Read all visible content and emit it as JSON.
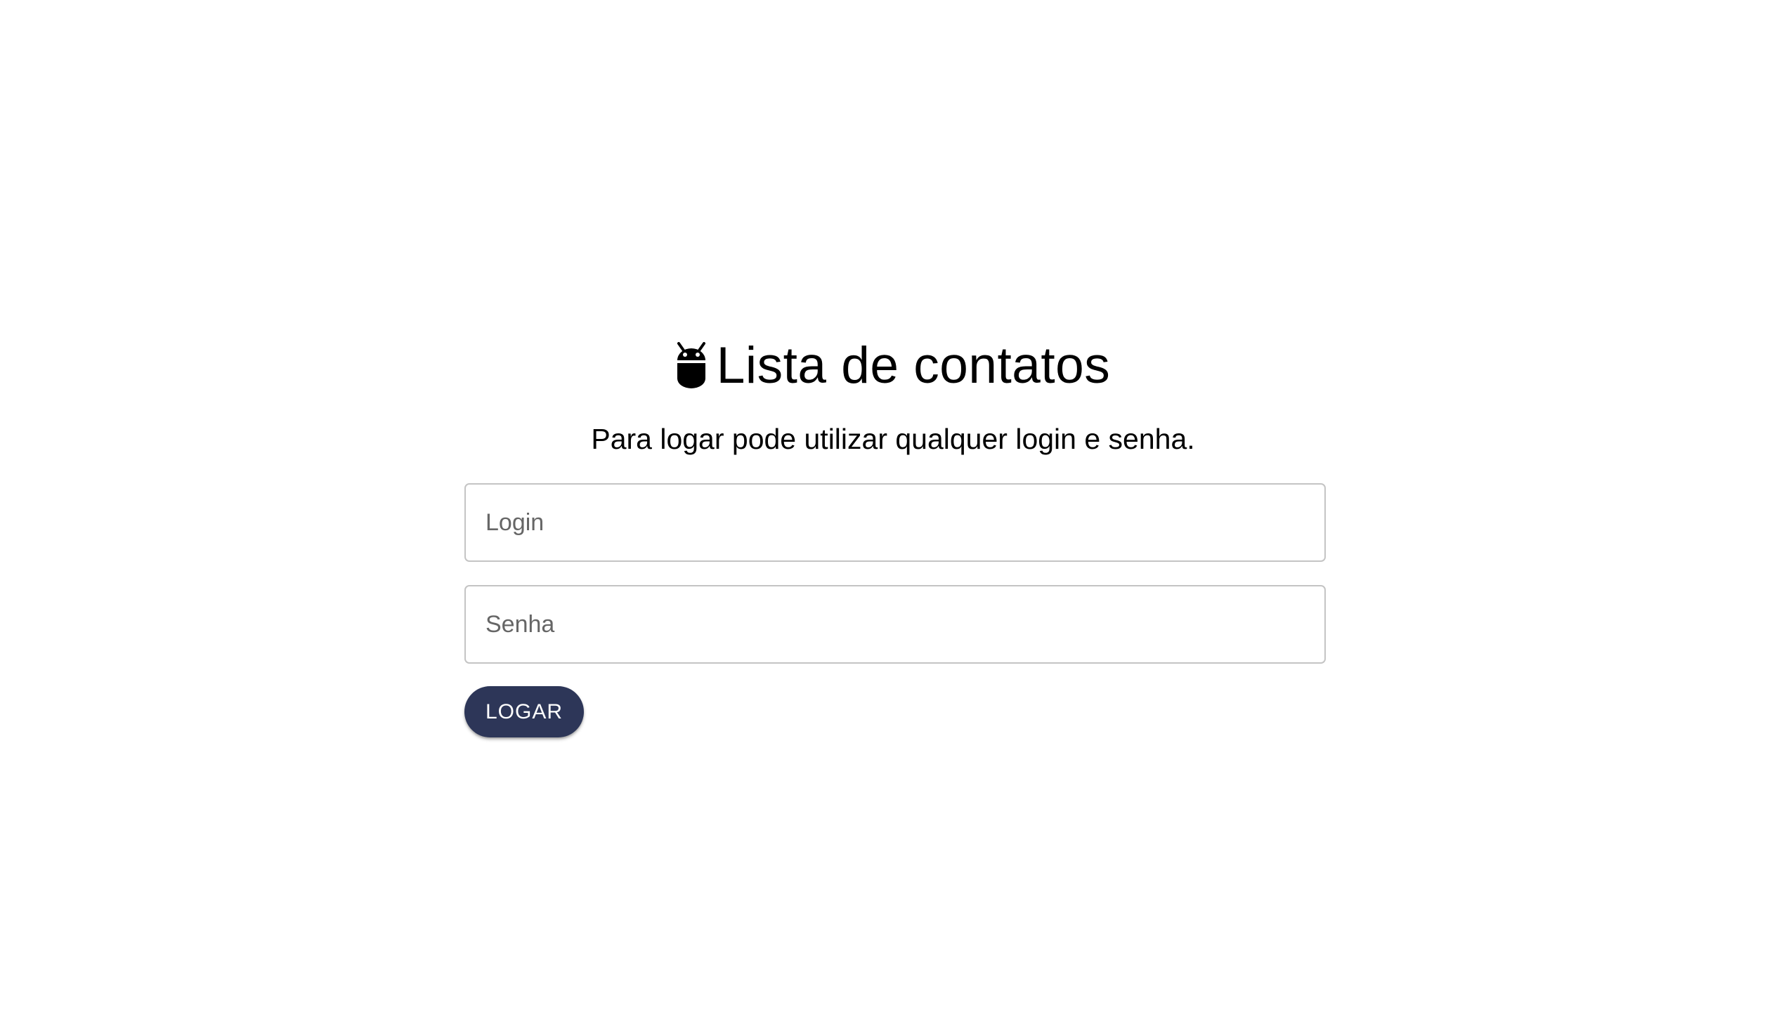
{
  "header": {
    "icon": "android-icon",
    "title": "Lista de contatos"
  },
  "subtitle": "Para logar pode utilizar qualquer login e senha.",
  "form": {
    "login": {
      "placeholder": "Login",
      "value": ""
    },
    "password": {
      "placeholder": "Senha",
      "value": ""
    },
    "submit_label": "LOGAR"
  },
  "colors": {
    "background": "#ffffff",
    "button": "#2d3658",
    "button_text": "#ffffff",
    "field_border": "#c4c4c4",
    "text": "#000000"
  }
}
